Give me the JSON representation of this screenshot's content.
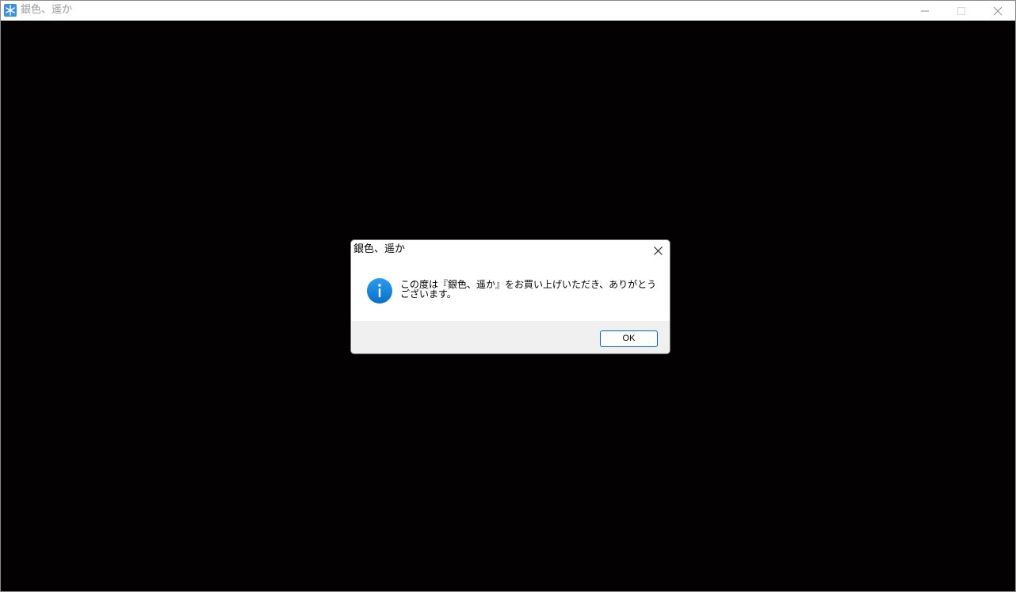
{
  "window": {
    "title": "銀色、遥か",
    "icon": "snowflake-app-icon",
    "controls": {
      "minimize": "minimize-icon",
      "maximize": "maximize-icon",
      "close": "close-icon"
    },
    "client_background": "#030102"
  },
  "dialog": {
    "title": "銀色、遥か",
    "icon": "info-icon",
    "message": "この度は『銀色、遥か』をお買い上げいただき、ありがとうございます。",
    "ok_label": "OK",
    "accent": "#1a8ae0"
  }
}
